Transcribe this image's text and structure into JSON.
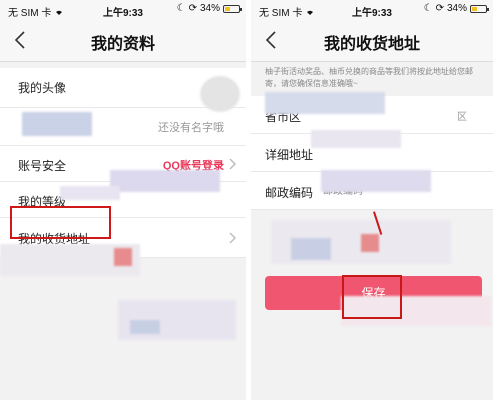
{
  "status_bar": {
    "carrier": "无 SIM 卡",
    "time": "上午9:33",
    "battery": "34%",
    "battery_level": 0.34
  },
  "left_screen": {
    "title": "我的资料",
    "rows": [
      {
        "label": "我的头像",
        "value": ""
      },
      {
        "label": "",
        "value": "还没有名字哦"
      },
      {
        "label": "账号安全",
        "value": "QQ账号登录"
      },
      {
        "label": "我的等级",
        "value": ""
      },
      {
        "label": "我的收货地址",
        "value": ""
      }
    ]
  },
  "right_screen": {
    "title": "我的收货地址",
    "notice": "柚子街活动奖品、柚币兑换的商品等我们将按此地址给您邮寄，请您确保信息准确哦~",
    "fields": [
      {
        "label": "省市区",
        "value": "区",
        "placeholder": ""
      },
      {
        "label": "详细地址",
        "value": "",
        "placeholder": ""
      },
      {
        "label": "邮政编码",
        "value": "",
        "placeholder": "邮政编码"
      }
    ],
    "save_label": "保存"
  },
  "colors": {
    "accent": "#f0566f",
    "link_red": "#e8385a",
    "annotation_red": "#c81818"
  }
}
